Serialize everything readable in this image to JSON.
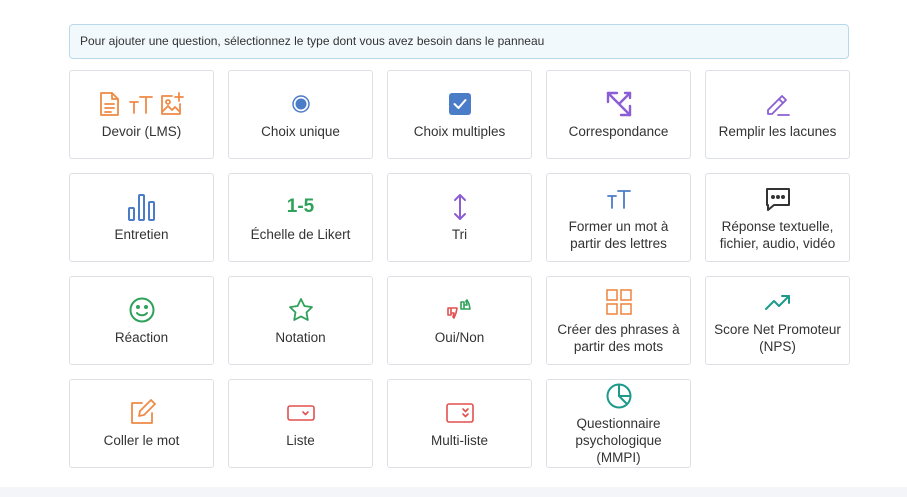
{
  "banner": {
    "text": "Pour ajouter une question, sélectionnez le type dont vous avez besoin dans le panneau"
  },
  "colors": {
    "orange": "#ee8a45",
    "blue": "#4a7cc7",
    "purple": "#8b5ed6",
    "green": "#2fa15a",
    "dark": "#333333",
    "red": "#e2504f",
    "teal": "#1d9a8a",
    "salmon": "#ee9a7a"
  },
  "question_types": [
    {
      "label": "Devoir (LMS)",
      "icon": "assignment-icons"
    },
    {
      "label": "Choix unique",
      "icon": "radio-icon"
    },
    {
      "label": "Choix multiples",
      "icon": "checkbox-icon"
    },
    {
      "label": "Correspondance",
      "icon": "match-arrows-icon"
    },
    {
      "label": "Remplir les lacunes",
      "icon": "pencil-icon"
    },
    {
      "label": "Entretien",
      "icon": "bar-chart-icon"
    },
    {
      "label": "Échelle de Likert",
      "icon": "likert-icon",
      "icon_text": "1-5"
    },
    {
      "label": "Tri",
      "icon": "sort-arrows-icon"
    },
    {
      "label": "Former un mot à partir des lettres",
      "icon": "text-size-icon"
    },
    {
      "label": "Réponse textuelle, fichier, audio, vidéo",
      "icon": "message-icon"
    },
    {
      "label": "Réaction",
      "icon": "smile-icon"
    },
    {
      "label": "Notation",
      "icon": "star-icon"
    },
    {
      "label": "Oui/Non",
      "icon": "thumbs-icon"
    },
    {
      "label": "Créer des phrases à partir des mots",
      "icon": "grid-icon"
    },
    {
      "label": "Score Net Promoteur (NPS)",
      "icon": "trending-up-icon"
    },
    {
      "label": "Coller le mot",
      "icon": "edit-square-icon"
    },
    {
      "label": "Liste",
      "icon": "dropdown-icon"
    },
    {
      "label": "Multi-liste",
      "icon": "multi-dropdown-icon"
    },
    {
      "label": "Questionnaire psychologique (MMPI)",
      "icon": "pie-chart-icon"
    }
  ]
}
